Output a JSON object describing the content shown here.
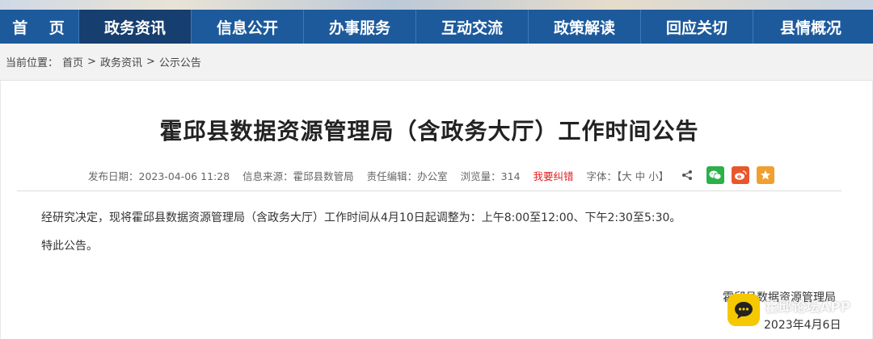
{
  "nav": {
    "items": [
      "首 页",
      "政务资讯",
      "信息公开",
      "办事服务",
      "互动交流",
      "政策解读",
      "回应关切",
      "县情概况"
    ]
  },
  "breadcrumb": {
    "prefix": "当前位置：",
    "items": [
      "首页",
      "政务资讯",
      "公示公告"
    ],
    "separator": ">"
  },
  "article": {
    "title": "霍邱县数据资源管理局（含政务大厅）工作时间公告",
    "meta": {
      "publish": "发布日期：2023-04-06 11:28",
      "source": "信息来源：霍邱县数管局",
      "editor": "责任编辑：办公室",
      "views": "浏览量：314",
      "correction": "我要纠错",
      "font_label": "字体：【大 中 小】"
    },
    "para1": "经研究决定，现将霍邱县数据资源管理局（含政务大厅）工作时间从4月10日起调整为：上午8:00至12:00、下午2:30至5:30。",
    "para2": "特此公告。",
    "signature_org": "霍邱县数据资源管理局",
    "signature_date": "2023年4月6日"
  },
  "watermark": {
    "text": "霍邱论坛APP"
  },
  "colors": {
    "nav_bg": "#1d5a9c",
    "nav_active": "#163e6e",
    "correction": "#e02020",
    "wechat": "#2bb04a",
    "weibo": "#e8572c",
    "favorite": "#f0a030"
  },
  "icons": [
    "share-icon",
    "wechat-icon",
    "weibo-icon",
    "favorite-star-icon"
  ]
}
